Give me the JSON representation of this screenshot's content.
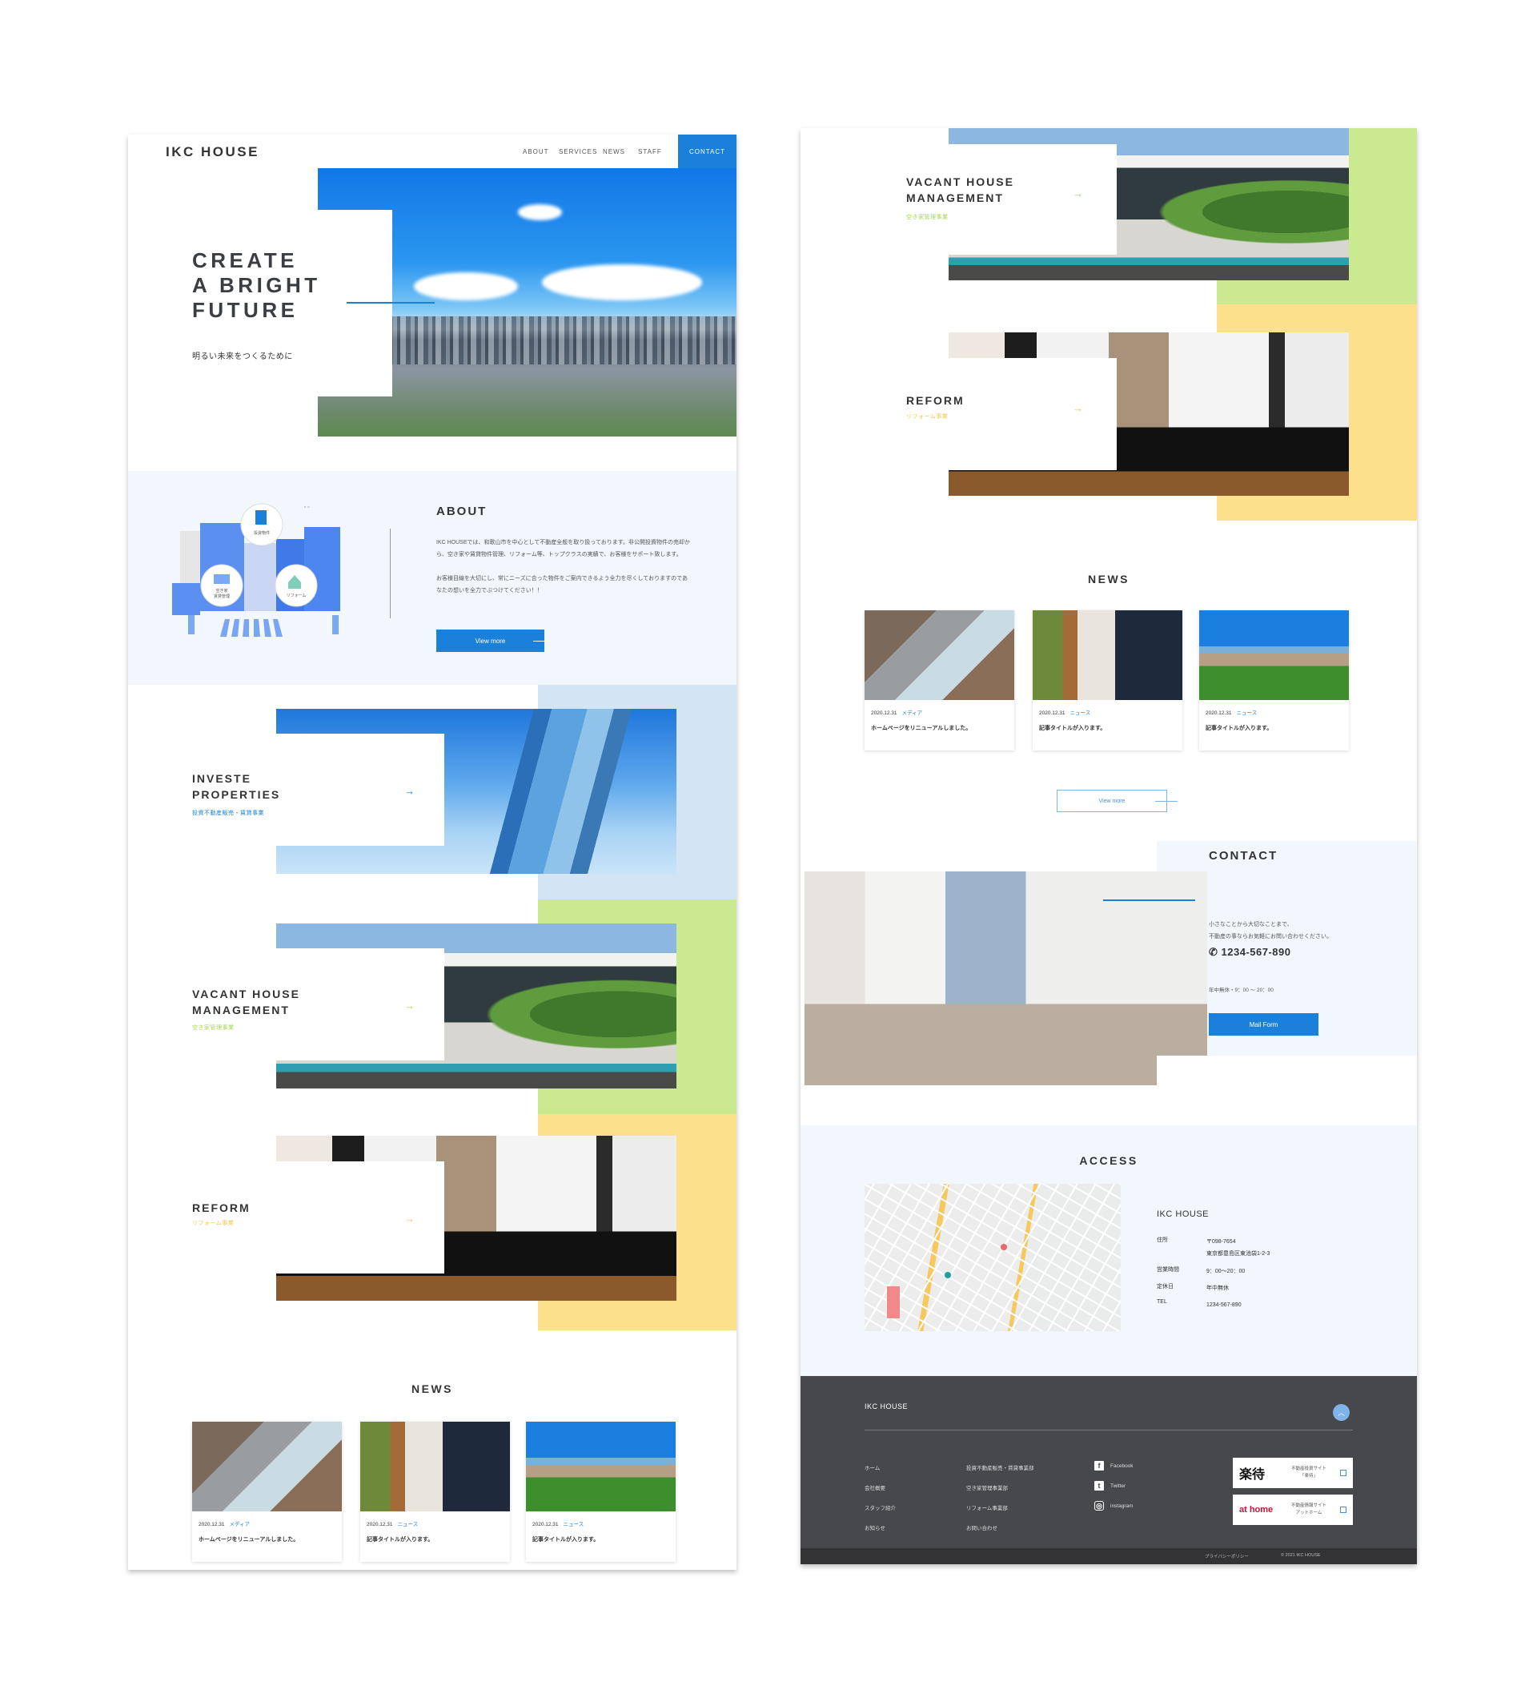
{
  "colors": {
    "accent_blue": "#1a80d9",
    "light_blue_bg": "#f2f7fe",
    "investe_bg": "#d3e4f4",
    "vacant_green": "#cbe990",
    "reform_yellow": "#fde08b",
    "footer_dark": "#47484c"
  },
  "header": {
    "logo": "IKC HOUSE",
    "nav": [
      "ABOUT",
      "SERVICES",
      "NEWS",
      "STAFF"
    ],
    "contact_label": "CONTACT"
  },
  "hero": {
    "title_lines": [
      "CREATE",
      "A BRIGHT",
      "FUTURE"
    ],
    "subtitle": "明るい未来をつくるために"
  },
  "about": {
    "title": "ABOUT",
    "paragraphs": [
      "IKC HOUSEでは、和歌山市を中心として不動産全般を取り扱っております。非公開投資物件の売却から、空き家や賃貸物件管理、リフォーム等、トップクラスの実績で、お客様をサポート致します。",
      "お客様目線を大切にし、常にニーズに合った物件をご案内できるよう全力を尽くしておりますのであなたの想いを全力でぶつけてください！！"
    ],
    "button_label": "View more",
    "illustration_labels": [
      "投資物件",
      "空き家\n賃貸管理",
      "リフォーム"
    ]
  },
  "services": [
    {
      "title_lines": [
        "INVESTE",
        "PROPERTIES"
      ],
      "subtitle": "投資不動産販売・賃貸事業",
      "color": "#1a80d9",
      "arrow": "→"
    },
    {
      "title_lines": [
        "VACANT HOUSE",
        "MANAGEMENT"
      ],
      "subtitle": "空き家管理事業",
      "color": "#a5d64f",
      "arrow": "→"
    },
    {
      "title_lines": [
        "REFORM"
      ],
      "subtitle": "リフォーム事業",
      "color": "#f5c54e",
      "arrow": "→"
    }
  ],
  "news": {
    "title": "NEWS",
    "items": [
      {
        "date": "2020.12.31",
        "category": "メディア",
        "title": "ホームページをリニューアルしました。"
      },
      {
        "date": "2020.12.31",
        "category": "ニュース",
        "title": "記事タイトルが入ります。"
      },
      {
        "date": "2020.12.31",
        "category": "ニュース",
        "title": "記事タイトルが入ります。"
      }
    ],
    "button_label": "View more"
  },
  "contact": {
    "title": "CONTACT",
    "text_lines": [
      "小さなことから大切なことまで、",
      "不動産の事ならお気軽にお問い合わせください。"
    ],
    "tel": "1234-567-890",
    "hours": "年中無休・9：00 ～ 20：00",
    "button_label": "Mail Form"
  },
  "access": {
    "title": "ACCESS",
    "company": "IKC HOUSE",
    "rows": [
      {
        "label": "住所",
        "value": "〒098-7654",
        "value2": "東京都豊島区東池袋1-2-3"
      },
      {
        "label": "営業時間",
        "value": "9：00～20：00"
      },
      {
        "label": "定休日",
        "value": "年中無休"
      },
      {
        "label": "TEL",
        "value": "1234-567-890"
      }
    ]
  },
  "footer": {
    "logo": "IKC HOUSE",
    "links_col1": [
      "ホーム",
      "会社概要",
      "スタッフ紹介",
      "お知らせ"
    ],
    "links_col2": [
      "投資不動産販売・賃貸事業部",
      "空き家管理事業部",
      "リフォーム事業部",
      "お問い合わせ"
    ],
    "social": [
      {
        "name": "Facebook",
        "icon": "facebook-icon"
      },
      {
        "name": "Twitter",
        "icon": "twitter-icon"
      },
      {
        "name": "instagram",
        "icon": "instagram-icon"
      }
    ],
    "banners": [
      {
        "brand": "楽待",
        "desc_lines": [
          "不動産投資サイト",
          "「楽待」"
        ]
      },
      {
        "brand": "at home",
        "desc_lines": [
          "不動産情報サイト",
          "アットホーム"
        ]
      }
    ],
    "privacy": "プライバシーポリシー",
    "copyright": "© 2021 IKC HOUSE"
  }
}
